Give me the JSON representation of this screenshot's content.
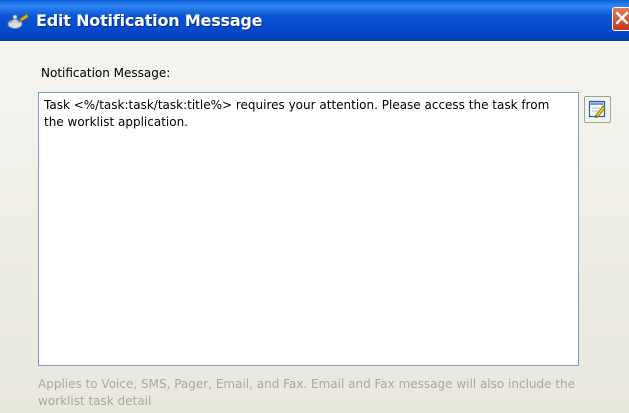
{
  "window": {
    "title": "Edit Notification Message",
    "app_icon": "oracle-task-icon",
    "close_icon": "close-icon"
  },
  "form": {
    "message_label": "Notification Message:",
    "message_value": "Task <%/task:task/task:title%> requires your attention. Please access the task from the worklist application.",
    "edit_icon": "edit-text-icon",
    "hint": "Applies to Voice, SMS, Pager, Email, and Fax. Email and Fax message will also include the worklist task detail"
  },
  "colors": {
    "titlebar": "#0a55d6",
    "close_button": "#d0482a",
    "hint_text": "#a9a9a0"
  }
}
